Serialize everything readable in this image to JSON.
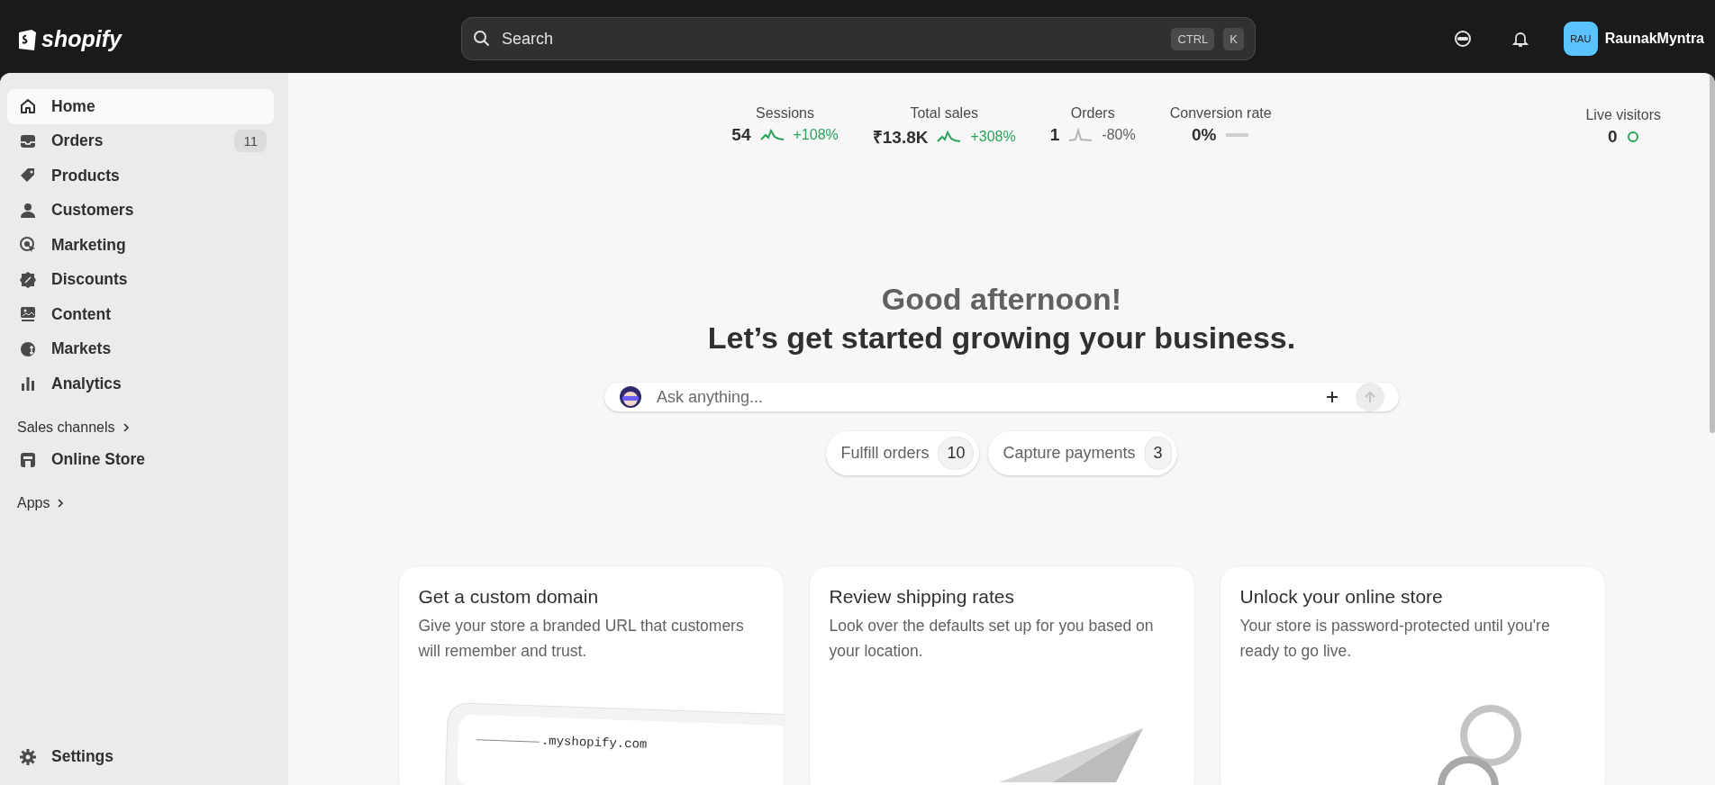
{
  "topbar": {
    "logo": "shopify",
    "search": {
      "placeholder": "Search",
      "keys": [
        "CTRL",
        "K"
      ]
    },
    "account": {
      "initials": "RAU",
      "name": "RaunakMyntra"
    }
  },
  "sidebar": {
    "items": [
      {
        "label": "Home",
        "selected": true
      },
      {
        "label": "Orders",
        "selected": false,
        "badge": "11"
      },
      {
        "label": "Products",
        "selected": false
      },
      {
        "label": "Customers",
        "selected": false
      },
      {
        "label": "Marketing",
        "selected": false
      },
      {
        "label": "Discounts",
        "selected": false
      },
      {
        "label": "Content",
        "selected": false
      },
      {
        "label": "Markets",
        "selected": false
      },
      {
        "label": "Analytics",
        "selected": false
      }
    ],
    "sections": [
      {
        "label": "Sales channels",
        "items": [
          {
            "label": "Online Store",
            "selected": false
          }
        ]
      },
      {
        "label": "Apps"
      }
    ],
    "settings": {
      "label": "Settings"
    }
  },
  "stats": [
    {
      "label": "Sessions",
      "value": "54",
      "change": "+108%",
      "kind": "rising"
    },
    {
      "label": "Total sales",
      "value": "₹13.8K",
      "change": "+308%",
      "kind": "rising"
    },
    {
      "label": "Orders",
      "value": "1",
      "change": "-80%",
      "kind": "falling"
    },
    {
      "label": "Conversion rate",
      "value": "0%",
      "kind": "flat"
    }
  ],
  "live": {
    "label": "Live visitors",
    "value": "0"
  },
  "greeting": "Good afternoon!",
  "headline": "Let’s get started growing your business.",
  "ask": {
    "placeholder": "Ask anything..."
  },
  "chips": [
    {
      "label": "Fulfill orders",
      "count": "10"
    },
    {
      "label": "Capture payments",
      "count": "3"
    }
  ],
  "cards": [
    {
      "title": "Get a custom domain",
      "text": "Give your store a branded URL that customers will remember and trust.",
      "kind": "domain",
      "illustration_text": ".myshopify.com"
    },
    {
      "title": "Review shipping rates",
      "text": "Look over the defaults set up for you based on your location.",
      "kind": "plane"
    },
    {
      "title": "Unlock your online store",
      "text": "Your store is password-protected until you're ready to go live.",
      "kind": "key"
    }
  ]
}
